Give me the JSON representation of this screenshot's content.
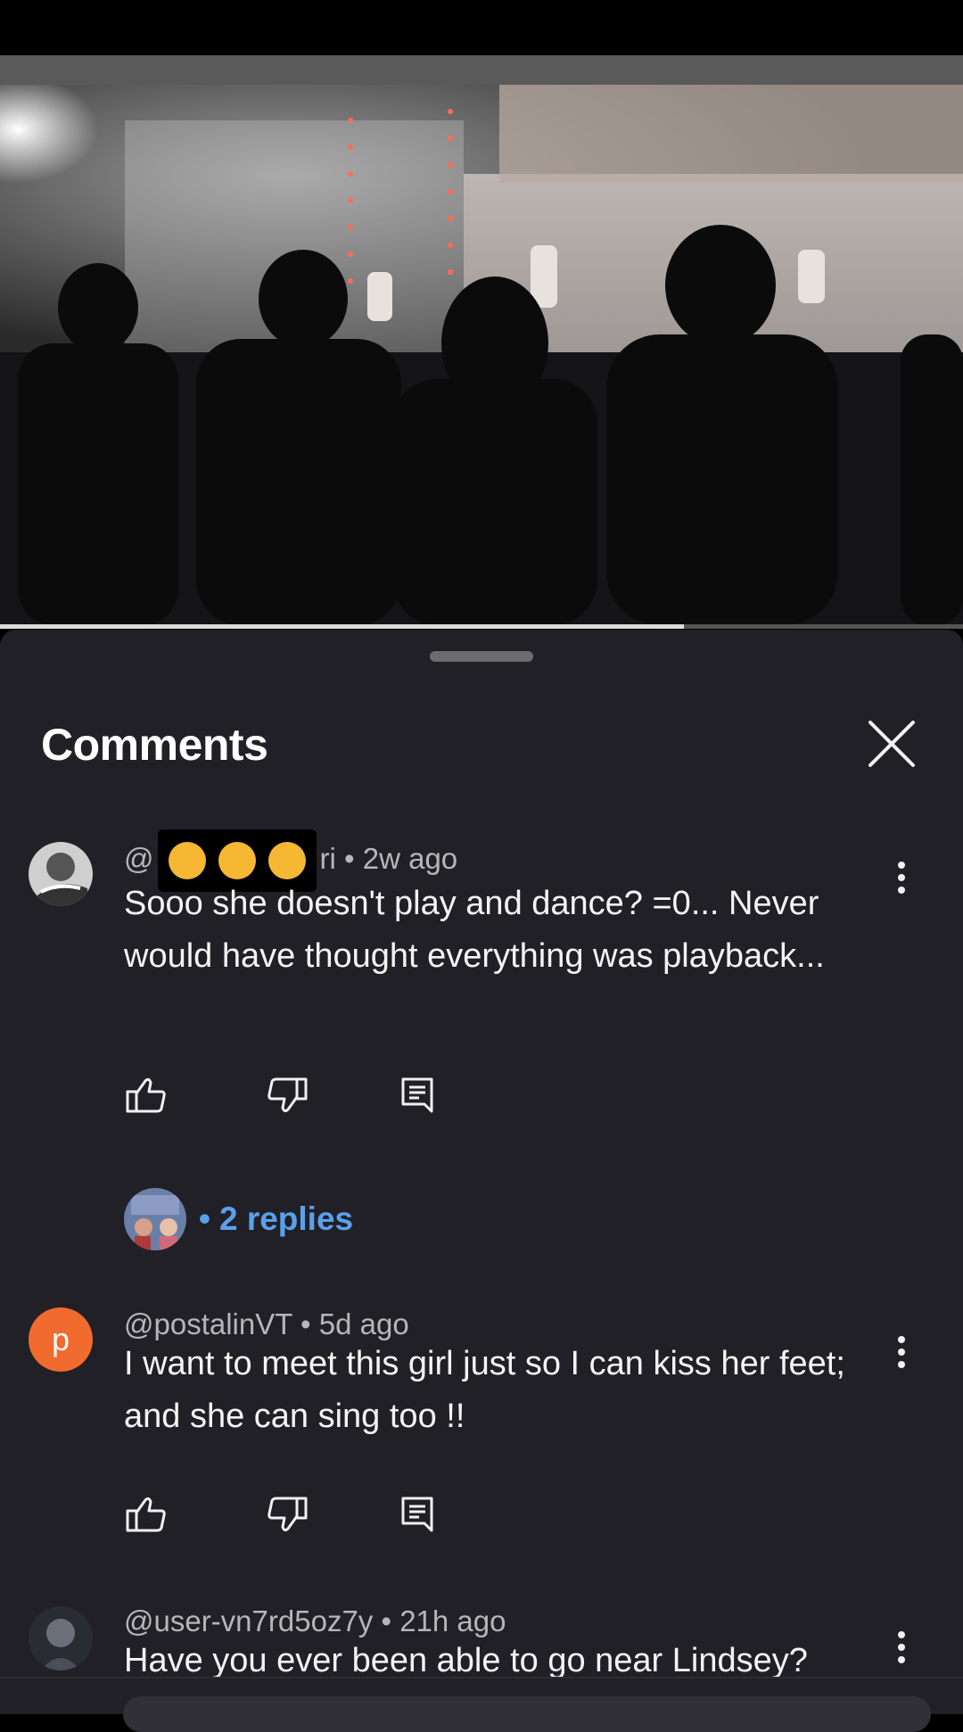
{
  "video": {
    "progress_percent": 71
  },
  "sheet": {
    "title": "Comments"
  },
  "comments": [
    {
      "author_prefix": "@",
      "author_suffix": "ri",
      "time": "2w ago",
      "text": "Sooo she doesn't play and dance? =0... Never would have thought everything was playback...",
      "replies_label": "2 replies"
    },
    {
      "author": "@postalinVT",
      "time": "5d ago",
      "text": "I want to meet this girl just so I can kiss her feet; and she can sing too !!",
      "avatar_letter": "p"
    },
    {
      "author": "@user-vn7rd5oz7y",
      "time": "21h ago",
      "text": "Have you ever been able to go near Lindsey?"
    }
  ],
  "separator": "•",
  "colors": {
    "sheet_bg": "#212026",
    "link_blue": "#5aa1ec",
    "avatar_orange": "#f16a2e"
  },
  "icons": [
    "close-icon",
    "thumbs-up-icon",
    "thumbs-down-icon",
    "reply-icon",
    "more-vert-icon"
  ]
}
